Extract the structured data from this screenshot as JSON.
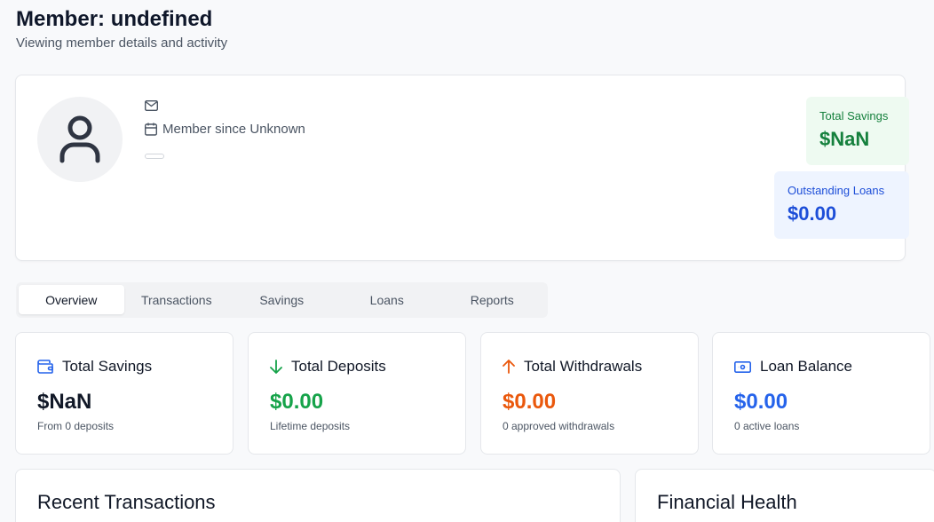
{
  "header": {
    "title": "Member: undefined",
    "subtitle": "Viewing member details and activity"
  },
  "profile": {
    "avatar_icon": "user-icon",
    "email": "",
    "member_since": "Member since Unknown",
    "total_savings_label": "Total Savings",
    "total_savings_value": "$NaN",
    "outstanding_loans_label": "Outstanding Loans",
    "outstanding_loans_value": "$0.00"
  },
  "tabs": [
    {
      "label": "Overview",
      "active": true
    },
    {
      "label": "Transactions",
      "active": false
    },
    {
      "label": "Savings",
      "active": false
    },
    {
      "label": "Loans",
      "active": false
    },
    {
      "label": "Reports",
      "active": false
    }
  ],
  "metrics": [
    {
      "title": "Total Savings",
      "value": "$NaN",
      "sub": "From 0 deposits",
      "icon": "wallet-icon",
      "color": "#111827"
    },
    {
      "title": "Total Deposits",
      "value": "$0.00",
      "sub": "Lifetime deposits",
      "icon": "arrow-down-icon",
      "color": "#16a34a"
    },
    {
      "title": "Total Withdrawals",
      "value": "$0.00",
      "sub": "0 approved withdrawals",
      "icon": "arrow-up-icon",
      "color": "#ea580c"
    },
    {
      "title": "Loan Balance",
      "value": "$0.00",
      "sub": "0 active loans",
      "icon": "banknote-icon",
      "color": "#2563eb"
    }
  ],
  "sections": {
    "recent_transactions": "Recent Transactions",
    "financial_health": "Financial Health"
  },
  "colors": {
    "savings_green": "#15803d",
    "loans_blue": "#1d4ed8",
    "deposits_green": "#16a34a",
    "withdrawals_orange": "#ea580c",
    "loan_balance_blue": "#2563eb"
  }
}
